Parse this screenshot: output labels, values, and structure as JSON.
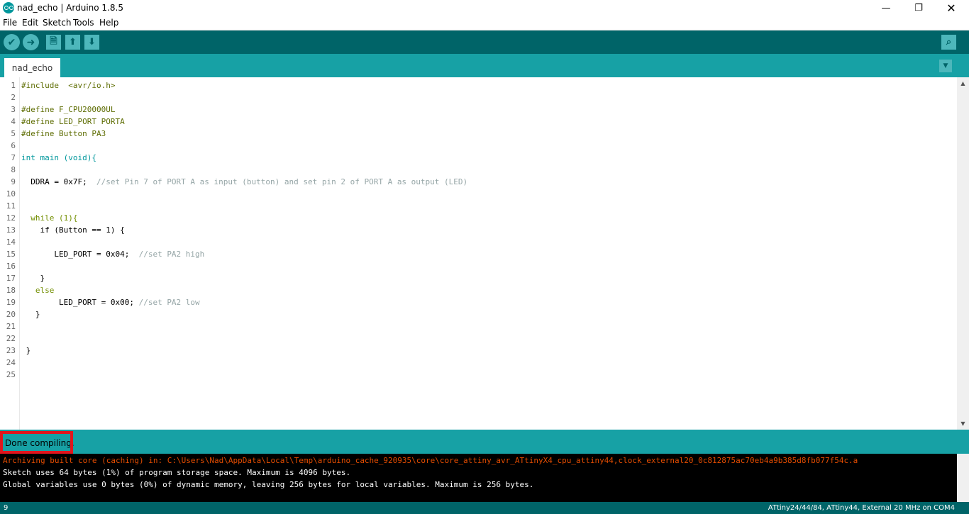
{
  "window": {
    "title": "nad_echo | Arduino 1.8.5",
    "minimize": "—",
    "maximize": "❐",
    "close": "✕"
  },
  "menu": [
    "File",
    "Edit",
    "Sketch",
    "Tools",
    "Help"
  ],
  "toolbar": {
    "verify_icon": "✔",
    "upload_icon": "➜",
    "new_icon": "🗎",
    "open_icon": "⬆",
    "save_icon": "⬇",
    "serial_monitor_icon": "⌕"
  },
  "tab": {
    "name": "nad_echo",
    "menu_icon": "▼"
  },
  "editor": {
    "line_numbers": [
      "1",
      "2",
      "3",
      "4",
      "5",
      "6",
      "7",
      "8",
      "9",
      "10",
      "11",
      "12",
      "13",
      "14",
      "15",
      "16",
      "17",
      "18",
      "19",
      "20",
      "21",
      "22",
      "23",
      "24",
      "25"
    ],
    "lines": {
      "l1": "#include  <avr/io.h>",
      "l3": "#define F_CPU20000UL",
      "l4": "#define LED_PORT PORTA",
      "l5": "#define Button PA3",
      "l7": "int main (void){",
      "l9_code": "  DDRA = 0x7F;  ",
      "l9_comment": "//set Pin 7 of PORT A as input (button) and set pin 2 of PORT A as output (LED)",
      "l12": "  while (1){",
      "l13": "    if (Button == 1) {",
      "l15_code": "       LED_PORT = 0x04;  ",
      "l15_comment": "//set PA2 high",
      "l17": "    }",
      "l18": "   else",
      "l19_code": "        LED_PORT = 0x00; ",
      "l19_comment": "//set PA2 low",
      "l20": "   }",
      "l23": " }"
    }
  },
  "status": {
    "message": "Done compiling."
  },
  "console": {
    "lines": [
      "Archiving built core (caching) in: C:\\Users\\Nad\\AppData\\Local\\Temp\\arduino_cache_920935\\core\\core_attiny_avr_ATtinyX4_cpu_attiny44,clock_external20_0c812875ac70eb4a9b385d8fb077f54c.a",
      "Sketch uses 64 bytes (1%) of program storage space. Maximum is 4096 bytes.",
      "Global variables use 0 bytes (0%) of dynamic memory, leaving 256 bytes for local variables. Maximum is 256 bytes."
    ]
  },
  "footer": {
    "line": "9",
    "board": "ATtiny24/44/84, ATtiny44, External 20 MHz on COM4"
  },
  "colors": {
    "toolbar": "#006468",
    "tabbar": "#17a1a5",
    "highlight": "#e0161d"
  }
}
